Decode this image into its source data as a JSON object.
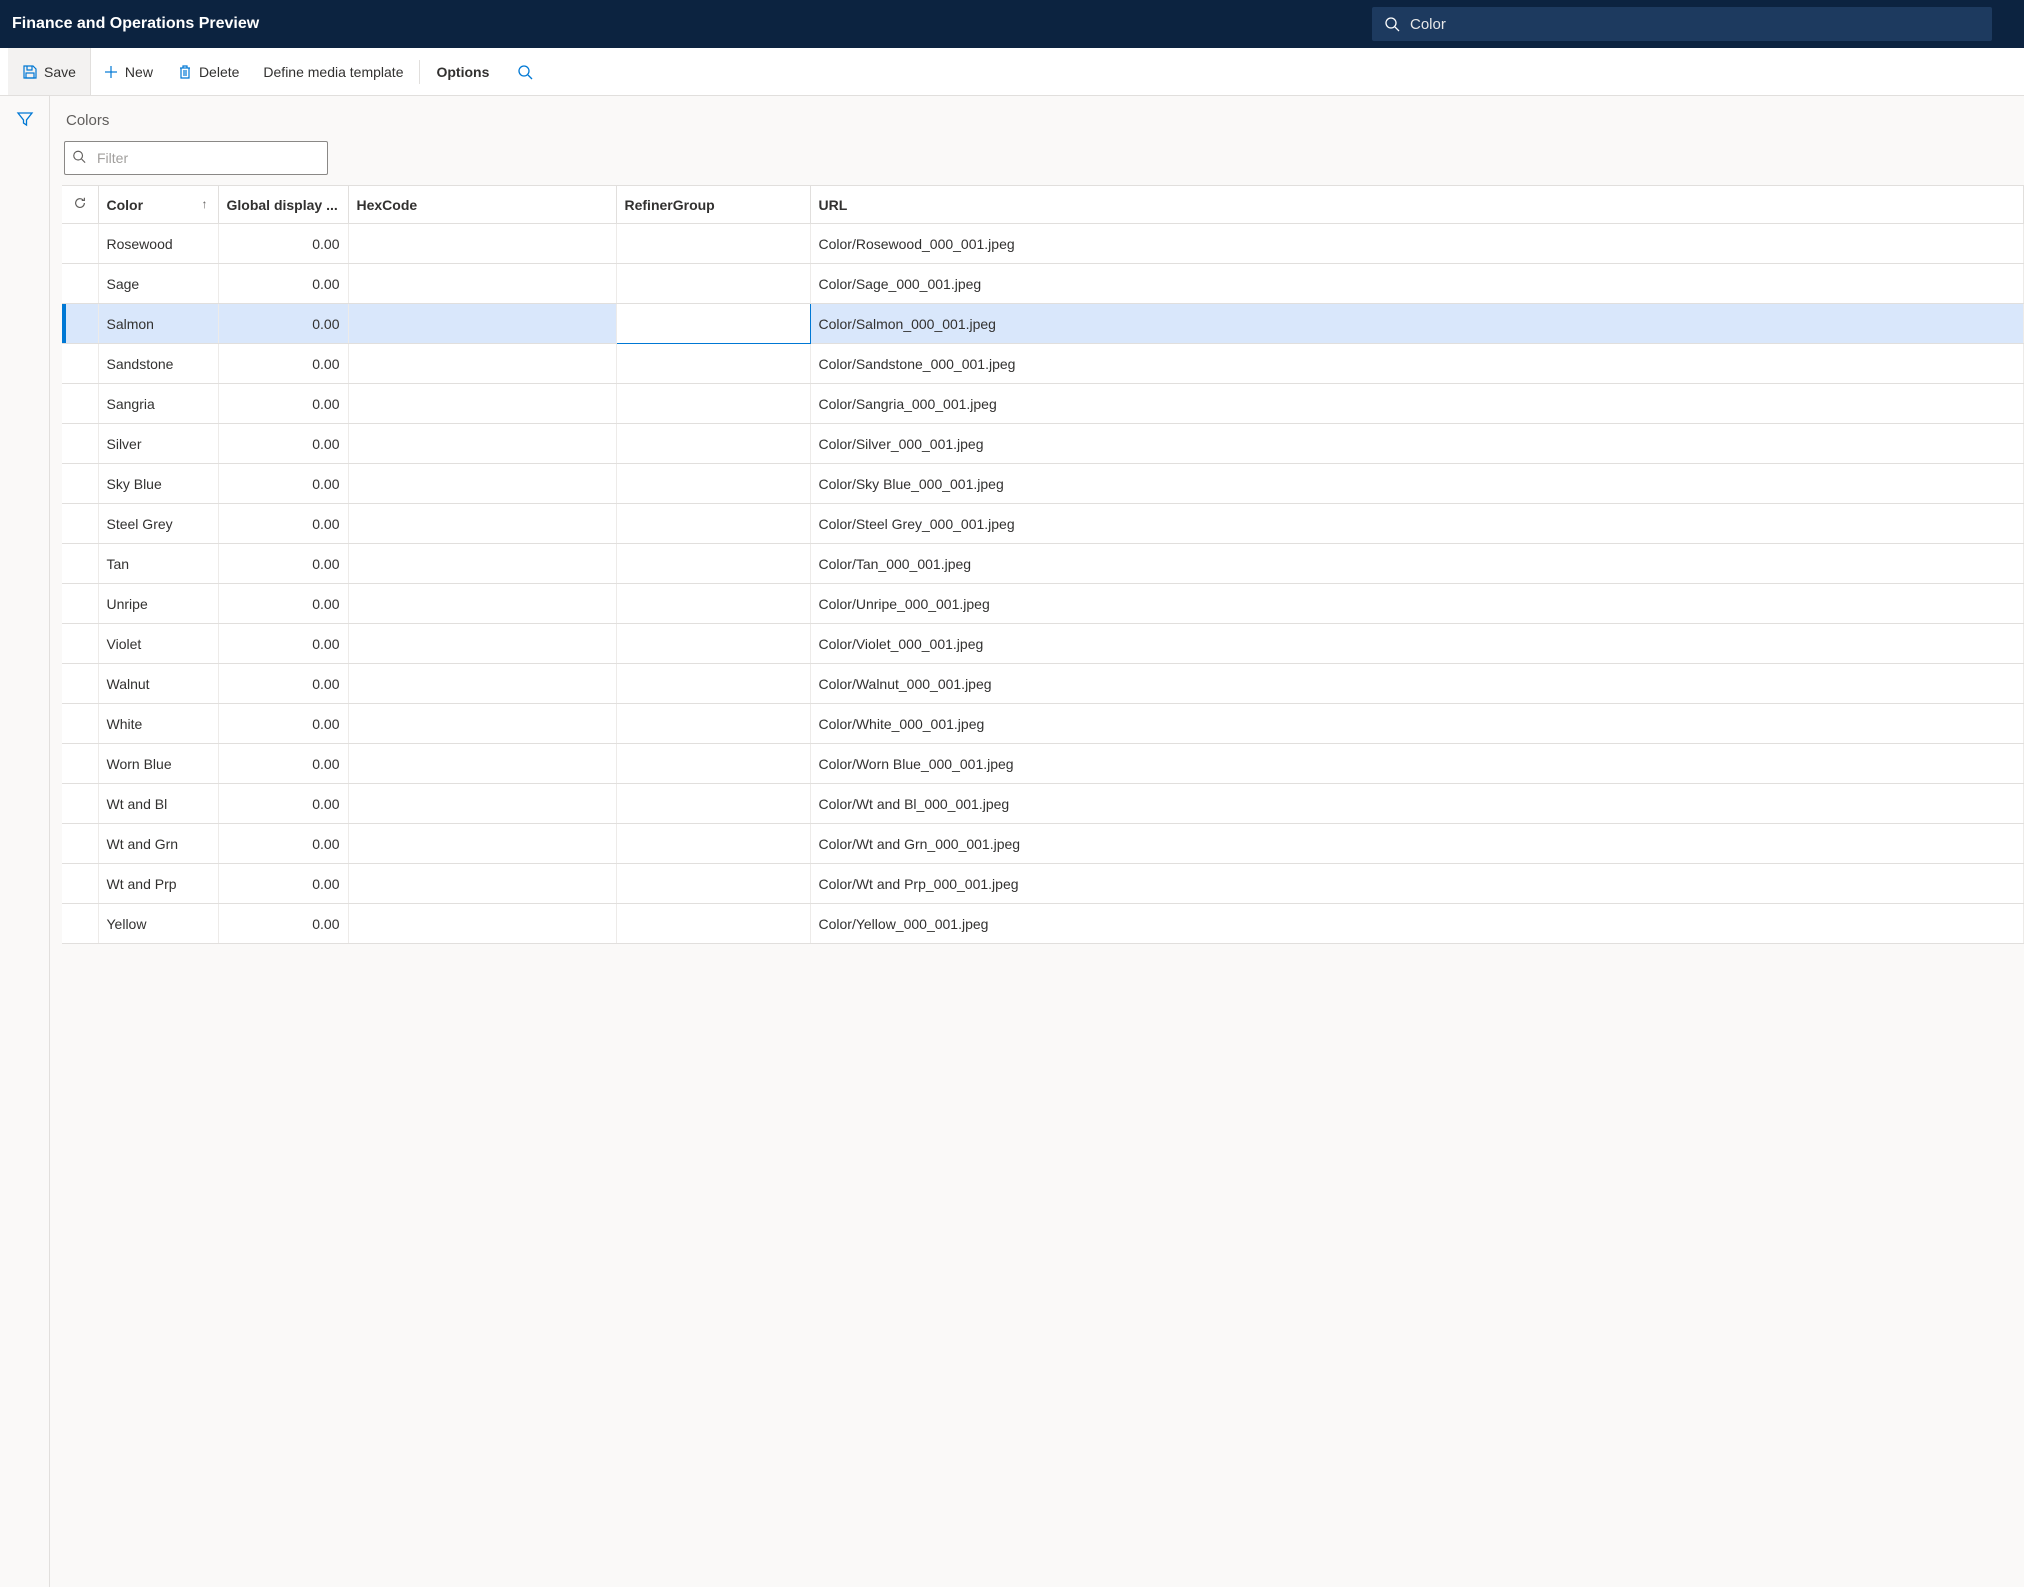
{
  "header": {
    "title": "Finance and Operations Preview",
    "search_value": "Color"
  },
  "toolbar": {
    "save": "Save",
    "new": "New",
    "delete": "Delete",
    "define_media": "Define media template",
    "options": "Options"
  },
  "content": {
    "title": "Colors",
    "filter_placeholder": "Filter"
  },
  "columns": {
    "color": "Color",
    "global_display": "Global display ...",
    "hexcode": "HexCode",
    "refiner_group": "RefinerGroup",
    "url": "URL"
  },
  "rows": [
    {
      "color": "Rosewood",
      "display": "0.00",
      "hex": "",
      "refiner": "",
      "url": "Color/Rosewood_000_001.jpeg",
      "selected": false
    },
    {
      "color": "Sage",
      "display": "0.00",
      "hex": "",
      "refiner": "",
      "url": "Color/Sage_000_001.jpeg",
      "selected": false
    },
    {
      "color": "Salmon",
      "display": "0.00",
      "hex": "",
      "refiner": "",
      "url": "Color/Salmon_000_001.jpeg",
      "selected": true
    },
    {
      "color": "Sandstone",
      "display": "0.00",
      "hex": "",
      "refiner": "",
      "url": "Color/Sandstone_000_001.jpeg",
      "selected": false
    },
    {
      "color": "Sangria",
      "display": "0.00",
      "hex": "",
      "refiner": "",
      "url": "Color/Sangria_000_001.jpeg",
      "selected": false
    },
    {
      "color": "Silver",
      "display": "0.00",
      "hex": "",
      "refiner": "",
      "url": "Color/Silver_000_001.jpeg",
      "selected": false
    },
    {
      "color": "Sky Blue",
      "display": "0.00",
      "hex": "",
      "refiner": "",
      "url": "Color/Sky Blue_000_001.jpeg",
      "selected": false
    },
    {
      "color": "Steel Grey",
      "display": "0.00",
      "hex": "",
      "refiner": "",
      "url": "Color/Steel Grey_000_001.jpeg",
      "selected": false
    },
    {
      "color": "Tan",
      "display": "0.00",
      "hex": "",
      "refiner": "",
      "url": "Color/Tan_000_001.jpeg",
      "selected": false
    },
    {
      "color": "Unripe",
      "display": "0.00",
      "hex": "",
      "refiner": "",
      "url": "Color/Unripe_000_001.jpeg",
      "selected": false
    },
    {
      "color": "Violet",
      "display": "0.00",
      "hex": "",
      "refiner": "",
      "url": "Color/Violet_000_001.jpeg",
      "selected": false
    },
    {
      "color": "Walnut",
      "display": "0.00",
      "hex": "",
      "refiner": "",
      "url": "Color/Walnut_000_001.jpeg",
      "selected": false
    },
    {
      "color": "White",
      "display": "0.00",
      "hex": "",
      "refiner": "",
      "url": "Color/White_000_001.jpeg",
      "selected": false
    },
    {
      "color": "Worn Blue",
      "display": "0.00",
      "hex": "",
      "refiner": "",
      "url": "Color/Worn Blue_000_001.jpeg",
      "selected": false
    },
    {
      "color": "Wt and Bl",
      "display": "0.00",
      "hex": "",
      "refiner": "",
      "url": "Color/Wt and Bl_000_001.jpeg",
      "selected": false
    },
    {
      "color": "Wt and Grn",
      "display": "0.00",
      "hex": "",
      "refiner": "",
      "url": "Color/Wt and Grn_000_001.jpeg",
      "selected": false
    },
    {
      "color": "Wt and Prp",
      "display": "0.00",
      "hex": "",
      "refiner": "",
      "url": "Color/Wt and Prp_000_001.jpeg",
      "selected": false
    },
    {
      "color": "Yellow",
      "display": "0.00",
      "hex": "",
      "refiner": "",
      "url": "Color/Yellow_000_001.jpeg",
      "selected": false
    }
  ]
}
